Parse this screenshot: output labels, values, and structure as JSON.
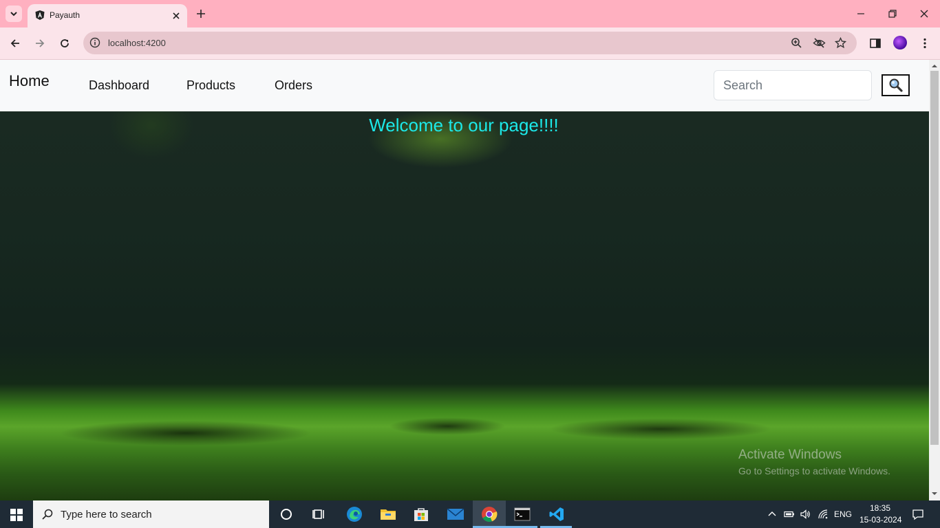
{
  "browser": {
    "tab_title": "Payauth",
    "url": "localhost:4200"
  },
  "navbar": {
    "brand": "Home",
    "links": [
      "Dashboard",
      "Products",
      "Orders"
    ],
    "search_placeholder": "Search"
  },
  "hero": {
    "title": "Welcome to our page!!!!"
  },
  "watermark": {
    "title": "Activate Windows",
    "subtitle": "Go to Settings to activate Windows."
  },
  "taskbar": {
    "search_placeholder": "Type here to search",
    "language": "ENG",
    "time": "18:35",
    "date": "15-03-2024"
  },
  "colors": {
    "tabbar": "#ffb0c0",
    "toolbar": "#fbe4ea",
    "hero_title": "#1ce8e8",
    "taskbar": "#1f2b36"
  },
  "icons": [
    "tab-search-icon",
    "angular-favicon-icon",
    "close-icon",
    "plus-icon",
    "minimize-icon",
    "restore-icon",
    "back-arrow-icon",
    "forward-arrow-icon",
    "reload-icon",
    "site-info-icon",
    "zoom-icon",
    "eye-off-icon",
    "star-icon",
    "side-panel-icon",
    "kebab-menu-icon",
    "magnifier-icon",
    "windows-start-icon",
    "cortana-icon",
    "task-view-icon",
    "edge-icon",
    "file-explorer-icon",
    "store-icon",
    "mail-icon",
    "chrome-icon",
    "terminal-icon",
    "vscode-icon",
    "chevron-up-icon",
    "battery-icon",
    "volume-icon",
    "wifi-icon",
    "notification-icon"
  ]
}
